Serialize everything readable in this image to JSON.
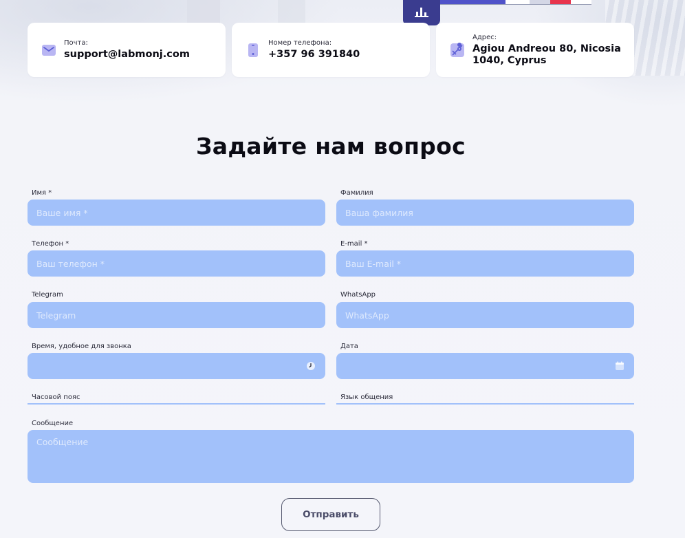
{
  "contacts": {
    "email": {
      "label": "Почта:",
      "value": "support@labmonj.com",
      "icon": "mail-icon"
    },
    "phone": {
      "label": "Номер телефона:",
      "value": "+357 96 391840",
      "icon": "phone-icon"
    },
    "address": {
      "label": "Адрес:",
      "line1": "Agiou Andreou 80, Nicosia",
      "line2": "1040, Cyprus",
      "icon": "map-pin-icon"
    }
  },
  "heading": "Задайте нам вопрос",
  "form": {
    "first_name": {
      "label": "Имя *",
      "placeholder": "Ваше имя *"
    },
    "last_name": {
      "label": "Фамилия",
      "placeholder": "Ваша фамилия"
    },
    "phone": {
      "label": "Телефон *",
      "placeholder": "Ваш телефон *"
    },
    "email": {
      "label": "E-mail *",
      "placeholder": "Ваш E-mail *"
    },
    "telegram": {
      "label": "Telegram",
      "placeholder": "Telegram"
    },
    "whatsapp": {
      "label": "WhatsApp",
      "placeholder": "WhatsApp"
    },
    "call_time": {
      "label": "Время, удобное для звонка",
      "icon": "clock-icon"
    },
    "date": {
      "label": "Дата",
      "icon": "calendar-icon"
    },
    "timezone": {
      "label": "Часовой пояс"
    },
    "language": {
      "label": "Язык общения"
    },
    "message": {
      "label": "Сообщение",
      "placeholder": "Сообщение"
    },
    "submit_label": "Отправить"
  },
  "colors": {
    "accent": "#3a3c8f",
    "field_bg": "#a2c1fa",
    "icon_purple": "#5d5fd6",
    "icon_bg": "#b9b6f3"
  }
}
